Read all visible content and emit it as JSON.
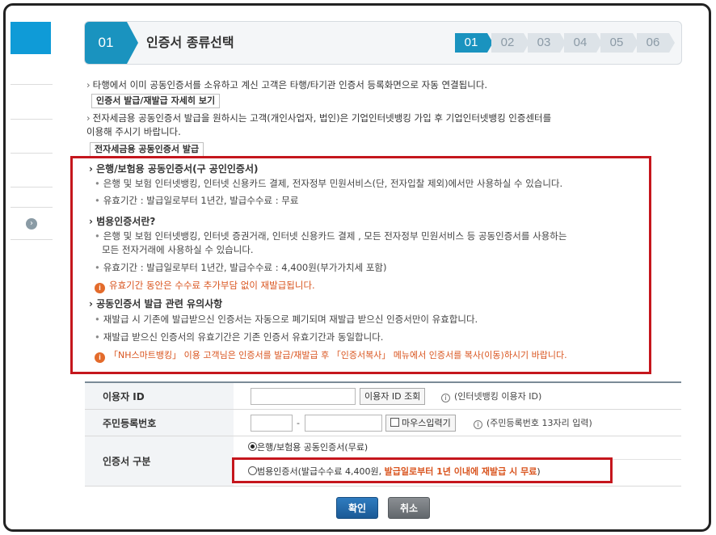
{
  "header": {
    "current_step_number": "01",
    "title": "인증서 종류선택",
    "steps": [
      "01",
      "02",
      "03",
      "04",
      "05",
      "06"
    ],
    "active_step": "01"
  },
  "intro": {
    "line1": "타행에서 이미 공동인증서를 소유하고 계신 고객은 타행/타기관 인증서 등록화면으로 자동 연결됩니다.",
    "btn1": "인증서 발급/재발급 자세히 보기",
    "line2a": "전자세금용 공동인증서 발급을 원하시는 고객(개인사업자, 법인)은 기업인터넷뱅킹 가입 후 기업인터넷뱅킹 인증센터를",
    "line2b": "이용해 주시기 바랍니다.",
    "btn2": "전자세금용 공동인증서 발급"
  },
  "notice": {
    "sec1_title": "은행/보험용 공동인증서(구 공인인증서)",
    "sec1_item1": "은행 및 보험 인터넷뱅킹, 인터넷 신용카드 결제, 전자정부 민원서비스(단, 전자입찰 제외)에서만 사용하실 수 있습니다.",
    "sec1_item2": "유효기간 : 발급일로부터 1년간, 발급수수료 : 무료",
    "sec2_title": "범용인증서란?",
    "sec2_item1a": "은행 및 보험 인터넷뱅킹, 인터넷 증권거래, 인터넷 신용카드 결제 , 모든 전자정부 민원서비스 등 공동인증서를 사용하는",
    "sec2_item1b": "모든 전자거래에 사용하실 수 있습니다.",
    "sec2_item2": "유효기간 : 발급일로부터 1년간, 발급수수료 : 4,400원(부가가치세 포함)",
    "sec2_warn": "유효기간 동안은 수수료 추가부담 없이 재발급됩니다.",
    "sec3_title": "공동인증서 발급 관련 유의사항",
    "sec3_item1": "재발급 시 기존에 발급받으신 인증서는 자동으로 폐기되며 재발급 받으신 인증서만이 유효합니다.",
    "sec3_item2": "재발급 받으신 인증서의 유효기간은 기존 인증서 유효기간과 동일합니다.",
    "sec3_warn": "「NH스마트뱅킹」 이용 고객님은 인증서를 발급/재발급 후 「인증서복사」 메뉴에서 인증서를 복사(이동)하시기 바랍니다."
  },
  "form": {
    "user_id_label": "이용자 ID",
    "user_id_value": "",
    "user_id_btn": "이용자 ID 조회",
    "user_id_hint": "(인터넷뱅킹 이용자 ID)",
    "rrn_label": "주민등록번호",
    "rrn_front": "",
    "rrn_dash": "-",
    "rrn_back": "",
    "mouse_input_label": "마우스입력기",
    "rrn_hint": "(주민등록번호 13자리 입력)",
    "cert_type_label": "인증서 구분",
    "opt1": "은행/보험용 공동인증서(무료)",
    "opt2_prefix": "범용인증서(발급수수료 4,400원, ",
    "opt2_emph": "발급일로부터 1년 이내에 재발급 시 무료",
    "opt2_suffix": ")",
    "hint_icon": "i",
    "warn_icon": "i"
  },
  "buttons": {
    "confirm": "확인",
    "cancel": "취소"
  },
  "colors": {
    "accent": "#1a93bf",
    "highlight_border": "#c5161d",
    "warning": "#d9541e"
  }
}
